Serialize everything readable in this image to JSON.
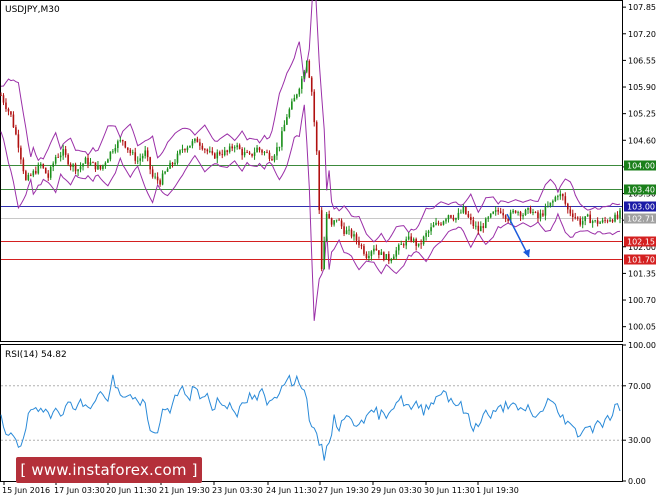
{
  "chart_data": [
    {
      "type": "candlestick",
      "title": "USDJPY,M30",
      "y_ticks": [
        "107.85",
        "107.20",
        "106.55",
        "105.90",
        "105.25",
        "104.60",
        "103.95",
        "103.30",
        "102.65",
        "102.00",
        "101.35",
        "100.70",
        "100.05"
      ],
      "ylim": [
        99.7,
        108.0
      ],
      "x_ticks": [
        "15 Jun 2016",
        "17 Jun 03:30",
        "20 Jun 11:30",
        "21 Jun 19:30",
        "23 Jun 03:30",
        "24 Jun 11:30",
        "27 Jun 19:30",
        "29 Jun 03:30",
        "30 Jun 11:30",
        "1 Jul 19:30"
      ],
      "levels": [
        {
          "label": "104.00",
          "value": 104.0,
          "color": "#1a7f1a",
          "line_color": "#3c8a3c"
        },
        {
          "label": "103.40",
          "value": 103.4,
          "color": "#1a7f1a",
          "line_color": "#3c8a3c"
        },
        {
          "label": "103.00",
          "value": 103.0,
          "color": "#1a1aa6",
          "line_color": "#3030b0"
        },
        {
          "label": "102.71",
          "value": 102.71,
          "color": "#a0a0a0",
          "line_color": "#c8c8c8"
        },
        {
          "label": "102.15",
          "value": 102.15,
          "color": "#d42020",
          "line_color": "#d42020"
        },
        {
          "label": "101.70",
          "value": 101.7,
          "color": "#d42020",
          "line_color": "#d42020"
        }
      ],
      "price_path": [
        [
          0,
          105.7
        ],
        [
          3,
          105.5
        ],
        [
          8,
          105.2
        ],
        [
          14,
          104.5
        ],
        [
          20,
          103.6
        ],
        [
          26,
          103.8
        ],
        [
          32,
          104.0
        ],
        [
          38,
          103.7
        ],
        [
          44,
          104.2
        ],
        [
          50,
          104.3
        ],
        [
          56,
          104.0
        ],
        [
          62,
          103.9
        ],
        [
          68,
          104.1
        ],
        [
          74,
          104.0
        ],
        [
          80,
          103.9
        ],
        [
          86,
          104.2
        ],
        [
          92,
          104.5
        ],
        [
          98,
          104.6
        ],
        [
          104,
          104.3
        ],
        [
          110,
          104.1
        ],
        [
          116,
          104.3
        ],
        [
          122,
          103.7
        ],
        [
          128,
          103.6
        ],
        [
          134,
          103.9
        ],
        [
          140,
          104.1
        ],
        [
          146,
          104.4
        ],
        [
          152,
          104.5
        ],
        [
          158,
          104.6
        ],
        [
          164,
          104.4
        ],
        [
          170,
          104.2
        ],
        [
          176,
          104.3
        ],
        [
          182,
          104.3
        ],
        [
          188,
          104.5
        ],
        [
          194,
          104.3
        ],
        [
          200,
          104.2
        ],
        [
          206,
          104.4
        ],
        [
          212,
          104.3
        ],
        [
          218,
          104.2
        ],
        [
          224,
          104.5
        ],
        [
          230,
          105.2
        ],
        [
          236,
          105.6
        ],
        [
          242,
          106.1
        ],
        [
          246,
          106.6
        ],
        [
          250,
          105.8
        ],
        [
          254,
          104.3
        ],
        [
          258,
          101.5
        ],
        [
          262,
          102.8
        ],
        [
          266,
          102.5
        ],
        [
          270,
          102.7
        ],
        [
          276,
          102.4
        ],
        [
          282,
          102.3
        ],
        [
          288,
          102.1
        ],
        [
          294,
          101.8
        ],
        [
          300,
          102.0
        ],
        [
          306,
          101.8
        ],
        [
          312,
          101.7
        ],
        [
          318,
          101.9
        ],
        [
          324,
          102.1
        ],
        [
          330,
          102.2
        ],
        [
          336,
          102.0
        ],
        [
          342,
          102.3
        ],
        [
          348,
          102.5
        ],
        [
          354,
          102.6
        ],
        [
          360,
          102.8
        ],
        [
          366,
          102.7
        ],
        [
          372,
          102.9
        ],
        [
          378,
          102.6
        ],
        [
          384,
          102.4
        ],
        [
          390,
          102.6
        ],
        [
          396,
          102.8
        ],
        [
          402,
          102.9
        ],
        [
          408,
          102.7
        ],
        [
          414,
          102.9
        ],
        [
          420,
          102.8
        ],
        [
          426,
          102.9
        ],
        [
          432,
          102.7
        ],
        [
          438,
          102.9
        ],
        [
          444,
          103.1
        ],
        [
          448,
          103.3
        ],
        [
          452,
          103.2
        ],
        [
          456,
          102.9
        ],
        [
          460,
          102.8
        ],
        [
          466,
          102.6
        ],
        [
          472,
          102.7
        ],
        [
          478,
          102.6
        ],
        [
          484,
          102.6
        ],
        [
          490,
          102.7
        ],
        [
          496,
          102.7
        ],
        [
          498,
          102.8
        ]
      ],
      "forecast_arrow": {
        "from": 102.75,
        "to": 101.75,
        "color": "#1a5adc"
      }
    },
    {
      "type": "line",
      "title": "RSI(14) 54.82",
      "y_ticks": [
        "100.00",
        "70.00",
        "30.00",
        "0.00"
      ],
      "ylim": [
        0,
        100
      ],
      "levels": [
        70,
        30
      ],
      "series": [
        {
          "values": [
            [
              0,
              45
            ],
            [
              5,
              30
            ],
            [
              10,
              35
            ],
            [
              15,
              25
            ],
            [
              20,
              40
            ],
            [
              25,
              55
            ],
            [
              30,
              48
            ],
            [
              35,
              52
            ],
            [
              40,
              50
            ],
            [
              45,
              57
            ],
            [
              50,
              47
            ],
            [
              55,
              60
            ],
            [
              60,
              55
            ],
            [
              65,
              58
            ],
            [
              70,
              52
            ],
            [
              75,
              60
            ],
            [
              80,
              65
            ],
            [
              85,
              58
            ],
            [
              90,
              75
            ],
            [
              95,
              62
            ],
            [
              100,
              60
            ],
            [
              105,
              66
            ],
            [
              110,
              55
            ],
            [
              115,
              58
            ],
            [
              120,
              40
            ],
            [
              124,
              32
            ],
            [
              128,
              45
            ],
            [
              132,
              55
            ],
            [
              136,
              50
            ],
            [
              140,
              60
            ],
            [
              145,
              72
            ],
            [
              150,
              58
            ],
            [
              155,
              70
            ],
            [
              160,
              62
            ],
            [
              165,
              66
            ],
            [
              170,
              52
            ],
            [
              175,
              60
            ],
            [
              180,
              55
            ],
            [
              185,
              58
            ],
            [
              190,
              50
            ],
            [
              195,
              55
            ],
            [
              200,
              62
            ],
            [
              205,
              60
            ],
            [
              210,
              65
            ],
            [
              215,
              55
            ],
            [
              220,
              62
            ],
            [
              225,
              68
            ],
            [
              230,
              78
            ],
            [
              235,
              70
            ],
            [
              240,
              75
            ],
            [
              244,
              68
            ],
            [
              248,
              48
            ],
            [
              252,
              35
            ],
            [
              256,
              28
            ],
            [
              260,
              18
            ],
            [
              264,
              30
            ],
            [
              268,
              45
            ],
            [
              272,
              40
            ],
            [
              276,
              48
            ],
            [
              280,
              45
            ],
            [
              285,
              42
            ],
            [
              290,
              47
            ],
            [
              295,
              45
            ],
            [
              300,
              52
            ],
            [
              305,
              48
            ],
            [
              310,
              50
            ],
            [
              315,
              55
            ],
            [
              320,
              60
            ],
            [
              325,
              58
            ],
            [
              330,
              52
            ],
            [
              335,
              56
            ],
            [
              340,
              52
            ],
            [
              345,
              58
            ],
            [
              350,
              60
            ],
            [
              355,
              68
            ],
            [
              360,
              62
            ],
            [
              365,
              58
            ],
            [
              370,
              55
            ],
            [
              375,
              48
            ],
            [
              380,
              38
            ],
            [
              385,
              45
            ],
            [
              390,
              50
            ],
            [
              395,
              48
            ],
            [
              400,
              52
            ],
            [
              405,
              55
            ],
            [
              410,
              58
            ],
            [
              415,
              52
            ],
            [
              420,
              50
            ],
            [
              425,
              55
            ],
            [
              430,
              45
            ],
            [
              435,
              52
            ],
            [
              440,
              60
            ],
            [
              445,
              55
            ],
            [
              450,
              48
            ],
            [
              455,
              45
            ],
            [
              460,
              38
            ],
            [
              465,
              35
            ],
            [
              470,
              40
            ],
            [
              475,
              38
            ],
            [
              480,
              45
            ],
            [
              485,
              42
            ],
            [
              490,
              48
            ],
            [
              495,
              55
            ],
            [
              498,
              54.82
            ]
          ]
        }
      ]
    }
  ],
  "watermark": {
    "text": "[ www.instaforex.com ]"
  }
}
